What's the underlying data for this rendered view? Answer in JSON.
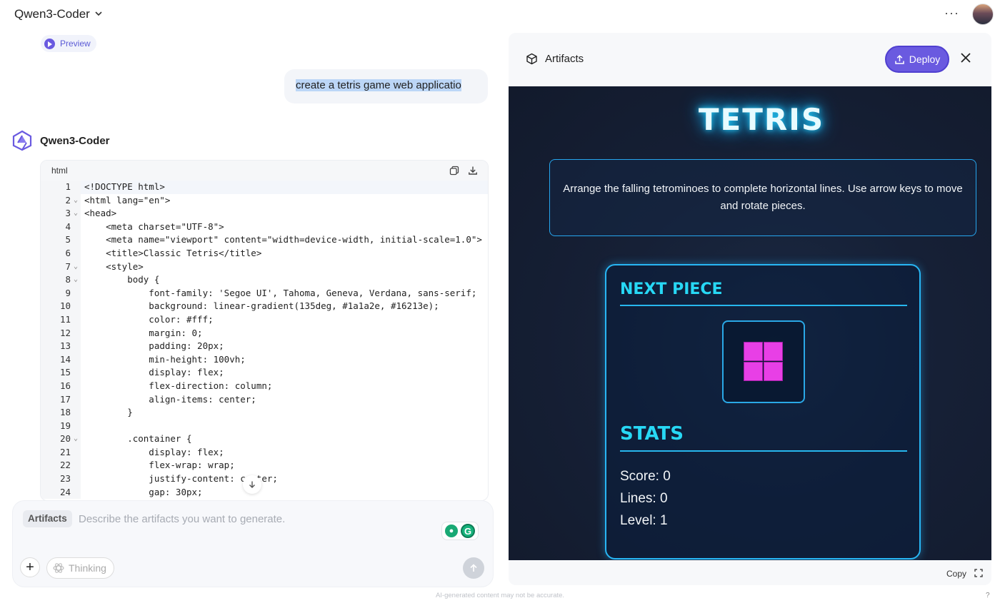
{
  "header": {
    "model_name": "Qwen3-Coder",
    "more_label": "···"
  },
  "chat": {
    "preview_label": "Preview",
    "user_message": "create a tetris game web applicatio",
    "bot_name": "Qwen3-Coder",
    "code_lang": "html",
    "code_lines": [
      "<!DOCTYPE html>",
      "<html lang=\"en\">",
      "<head>",
      "    <meta charset=\"UTF-8\">",
      "    <meta name=\"viewport\" content=\"width=device-width, initial-scale=1.0\">",
      "    <title>Classic Tetris</title>",
      "    <style>",
      "        body {",
      "            font-family: 'Segoe UI', Tahoma, Geneva, Verdana, sans-serif;",
      "            background: linear-gradient(135deg, #1a1a2e, #16213e);",
      "            color: #fff;",
      "            margin: 0;",
      "            padding: 20px;",
      "            min-height: 100vh;",
      "            display: flex;",
      "            flex-direction: column;",
      "            align-items: center;",
      "        }",
      "",
      "        .container {",
      "            display: flex;",
      "            flex-wrap: wrap;",
      "            justify-content: center;",
      "            gap: 30px;"
    ],
    "folded_lines": [
      2,
      3,
      7,
      8,
      20
    ]
  },
  "composer": {
    "chip_label": "Artifacts",
    "placeholder": "Describe the artifacts you want to generate.",
    "thinking_label": "Thinking"
  },
  "artifacts": {
    "title": "Artifacts",
    "deploy_label": "Deploy",
    "copy_label": "Copy",
    "game": {
      "title": "TETRIS",
      "description": "Arrange the falling tetrominoes to complete horizontal lines. Use arrow keys to move and rotate pieces.",
      "next_piece_heading": "NEXT PIECE",
      "stats_heading": "STATS",
      "score": "Score: 0",
      "lines": "Lines: 0",
      "level": "Level: 1",
      "piece_color": "#e83fe6"
    }
  },
  "footer": {
    "disclaimer": "AI-generated content may not be accurate.",
    "help": "?"
  },
  "colors": {
    "accent": "#6a5ae0",
    "neon": "#27d8f5"
  }
}
